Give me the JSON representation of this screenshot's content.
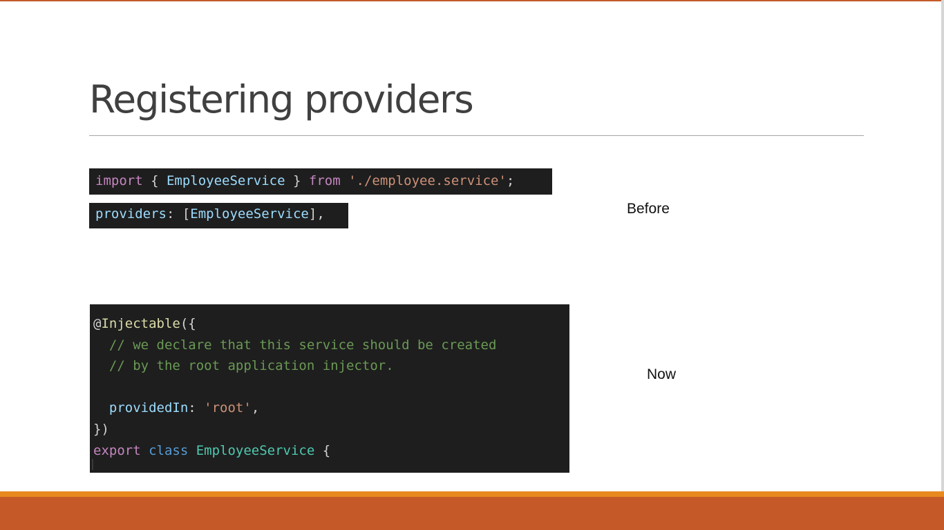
{
  "slide": {
    "title": "Registering providers",
    "labels": {
      "before": "Before",
      "now": "Now"
    }
  },
  "code_import": {
    "kw_import": "import",
    "brace_open": " { ",
    "symbol": "EmployeeService",
    "brace_close": " } ",
    "kw_from": "from",
    "space": " ",
    "path": "'./employee.service'",
    "semicolon": ";"
  },
  "code_providers": {
    "key": "providers",
    "colon_bracket": ": [",
    "symbol": "EmployeeService",
    "close": "],"
  },
  "code_injectable": {
    "line1_at": "@",
    "line1_decorator": "Injectable",
    "line1_rest": "({",
    "line2": "  // we declare that this service should be created",
    "line3": "  // by the root application injector.",
    "line5_indent": "  ",
    "line5_key": "providedIn",
    "line5_colon": ": ",
    "line5_value": "'root'",
    "line5_comma": ",",
    "line6": "})",
    "line7_export": "export",
    "line7_class": " class ",
    "line7_name": "EmployeeService",
    "line7_brace": " {"
  },
  "theme": {
    "accent": "#c55a28",
    "accent_light": "#e8891f",
    "code_bg": "#1e1e1e"
  }
}
